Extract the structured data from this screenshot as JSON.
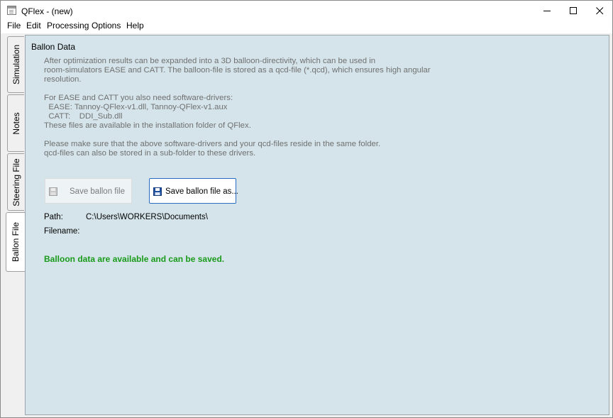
{
  "window": {
    "title": "QFlex - (new)"
  },
  "menu": [
    "File",
    "Edit",
    "Processing",
    "Options",
    "Help"
  ],
  "tabs": [
    "Simulation",
    "Notes",
    "Steering File",
    "Ballon File"
  ],
  "active_tab": "Ballon File",
  "panel": {
    "title": "Ballon Data",
    "description": [
      "After optimization results can be expanded into a 3D balloon-directivity, which can be used in",
      "room-simulators EASE and CATT. The balloon-file is stored as a qcd-file (*.qcd), which ensures high angular",
      "resolution.",
      "For EASE and CATT you also need software-drivers:",
      "  EASE: Tannoy-QFlex-v1.dll, Tannoy-QFlex-v1.aux",
      "  CATT:    DDI_Sub.dll",
      "These files are available in the installation folder of QFlex.",
      "Please make sure that the above software-drivers and your qcd-files reside in the same folder.",
      "qcd-files can also be stored in a sub-folder to these drivers."
    ],
    "buttons": {
      "save": "Save ballon file",
      "save_as": "Save ballon file as..."
    },
    "path_label": "Path:",
    "path_value": "C:\\Users\\WORKERS\\Documents\\",
    "filename_label": "Filename:",
    "filename_value": "",
    "status": "Balloon data are available and can be saved."
  },
  "colors": {
    "panel_bg": "#d4e4ea",
    "status_green": "#1a9a1a",
    "accent_blue": "#2a6cc0"
  }
}
